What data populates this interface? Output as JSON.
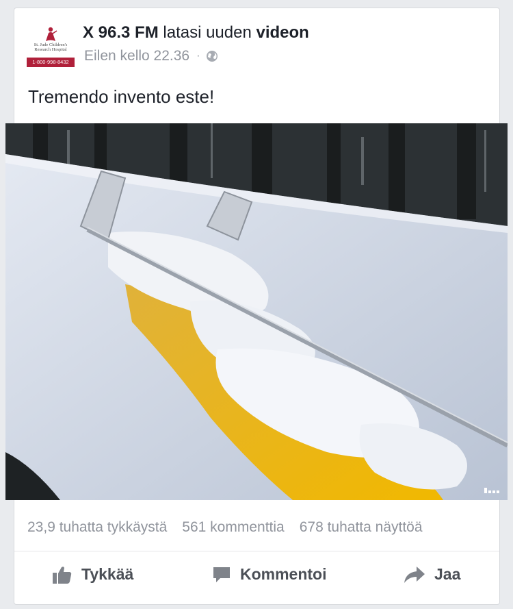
{
  "post": {
    "author": "X 96.3 FM",
    "action_text": " latasi uuden ",
    "object_text": "videon",
    "timestamp": "Eilen kello 22.36",
    "separator": "·",
    "privacy_icon": "globe-icon",
    "text": "Tremendo invento este!"
  },
  "avatar": {
    "logo_line1": "St. Jude Children's",
    "logo_line2": "Research Hospital",
    "phone": "1-800-998-8432",
    "brand_color": "#b0203a"
  },
  "video": {
    "corner_icon": "video-quality-icon"
  },
  "stats": {
    "likes": "23,9 tuhatta tykkäystä",
    "comments": "561 kommenttia",
    "views": "678 tuhatta näyttöä"
  },
  "actions": {
    "like_label": "Tykkää",
    "comment_label": "Kommentoi",
    "share_label": "Jaa",
    "like_icon": "thumbs-up-icon",
    "comment_icon": "comment-icon",
    "share_icon": "share-arrow-icon"
  },
  "colors": {
    "background": "#e9ebee",
    "card": "#ffffff",
    "muted_text": "#90949c",
    "action_text": "#4b4f56"
  }
}
